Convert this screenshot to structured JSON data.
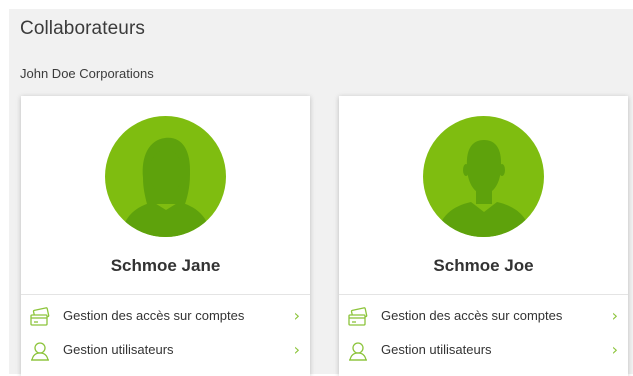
{
  "page": {
    "title": "Collaborateurs",
    "company": "John Doe Corporations"
  },
  "colors": {
    "accent": "#7fbd10",
    "avatar_figure": "#5ea20c",
    "icon_stroke": "#8cc43b"
  },
  "cards": [
    {
      "name": "Schmoe Jane",
      "avatar_icon": "female-avatar-icon",
      "actions": [
        {
          "label": "Gestion des accès sur comptes",
          "icon": "cards-icon",
          "chevron": "›"
        },
        {
          "label": "Gestion utilisateurs",
          "icon": "user-icon",
          "chevron": "›"
        }
      ]
    },
    {
      "name": "Schmoe Joe",
      "avatar_icon": "male-avatar-icon",
      "actions": [
        {
          "label": "Gestion des accès sur comptes",
          "icon": "cards-icon",
          "chevron": "›"
        },
        {
          "label": "Gestion utilisateurs",
          "icon": "user-icon",
          "chevron": "›"
        }
      ]
    }
  ]
}
